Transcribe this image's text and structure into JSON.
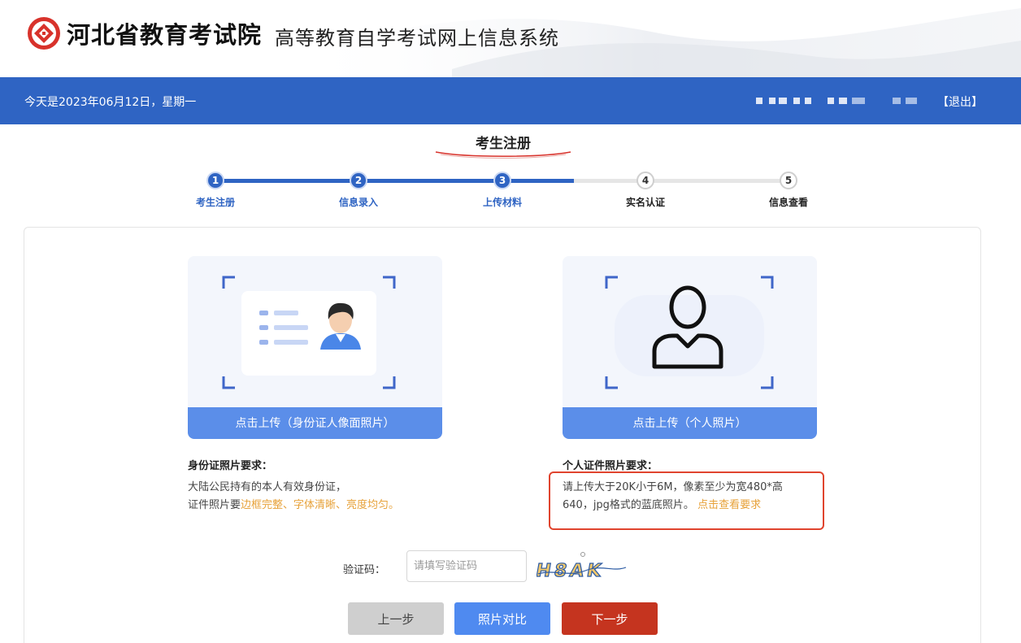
{
  "header": {
    "brand": "河北省教育考试院",
    "system_name": "高等教育自学考试网上信息系统",
    "logo_icon": "exam-institute-logo-icon"
  },
  "topbar": {
    "date_text": "今天是2023年06月12日，星期一",
    "logout_label": "【退出】"
  },
  "page": {
    "title": "考生注册"
  },
  "steps": [
    {
      "num": "1",
      "label": "考生注册",
      "done": true
    },
    {
      "num": "2",
      "label": "信息录入",
      "done": true
    },
    {
      "num": "3",
      "label": "上传材料",
      "done": true
    },
    {
      "num": "4",
      "label": "实名认证",
      "done": false
    },
    {
      "num": "5",
      "label": "信息查看",
      "done": false
    }
  ],
  "upload": {
    "id_card": {
      "button_label": "点击上传（身份证人像面照片）",
      "req_title": "身份证照片要求：",
      "req_line1": "大陆公民持有的本人有效身份证，",
      "req_line2_prefix": "证件照片要",
      "req_line2_highlight": "边框完整、字体清晰、亮度均匀。",
      "icon": "id-card-icon"
    },
    "personal": {
      "button_label": "点击上传（个人照片）",
      "req_title": "个人证件照片要求：",
      "req_line1": "请上传大于20K小于6M，像素至少为宽480*高",
      "req_line2": "640，jpg格式的蓝底照片。",
      "req_link": "点击查看要求",
      "icon": "person-silhouette-icon"
    }
  },
  "captcha": {
    "label": "验证码：",
    "placeholder": "请填写验证码",
    "value": "",
    "image_text": "H8AK"
  },
  "buttons": {
    "prev": "上一步",
    "compare": "照片对比",
    "next": "下一步"
  },
  "colors": {
    "primary_blue": "#2f64c3",
    "upload_blue": "#5b8ee9",
    "next_red": "#c5341f",
    "highlight_orange": "#e7a23a",
    "annotation_red": "#e0442e"
  }
}
